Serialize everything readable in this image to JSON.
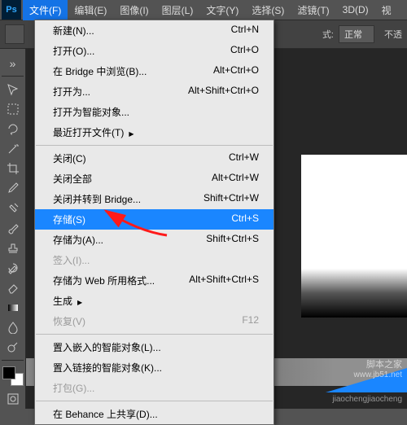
{
  "menubar": {
    "items": [
      {
        "label": "文件(F)"
      },
      {
        "label": "编辑(E)"
      },
      {
        "label": "图像(I)"
      },
      {
        "label": "图层(L)"
      },
      {
        "label": "文字(Y)"
      },
      {
        "label": "选择(S)"
      },
      {
        "label": "滤镜(T)"
      },
      {
        "label": "3D(D)"
      },
      {
        "label": "视"
      }
    ]
  },
  "options": {
    "mode_prefix": "式:",
    "mode_value": "正常",
    "opacity_label": "不透"
  },
  "dropdown": {
    "items": [
      {
        "label": "新建(N)...",
        "shortcut": "Ctrl+N"
      },
      {
        "label": "打开(O)...",
        "shortcut": "Ctrl+O"
      },
      {
        "label": "在 Bridge 中浏览(B)...",
        "shortcut": "Alt+Ctrl+O"
      },
      {
        "label": "打开为...",
        "shortcut": "Alt+Shift+Ctrl+O"
      },
      {
        "label": "打开为智能对象..."
      },
      {
        "label": "最近打开文件(T)",
        "submenu": true
      },
      {
        "sep": true
      },
      {
        "label": "关闭(C)",
        "shortcut": "Ctrl+W"
      },
      {
        "label": "关闭全部",
        "shortcut": "Alt+Ctrl+W"
      },
      {
        "label": "关闭并转到 Bridge...",
        "shortcut": "Shift+Ctrl+W"
      },
      {
        "label": "存储(S)",
        "shortcut": "Ctrl+S",
        "highlight": true
      },
      {
        "label": "存储为(A)...",
        "shortcut": "Shift+Ctrl+S"
      },
      {
        "label": "签入(I)...",
        "disabled": true
      },
      {
        "label": "存储为 Web 所用格式...",
        "shortcut": "Alt+Shift+Ctrl+S"
      },
      {
        "label": "生成",
        "submenu": true
      },
      {
        "label": "恢复(V)",
        "shortcut": "F12",
        "disabled": true
      },
      {
        "sep": true
      },
      {
        "label": "置入嵌入的智能对象(L)..."
      },
      {
        "label": "置入链接的智能对象(K)..."
      },
      {
        "label": "打包(G)...",
        "disabled": true
      },
      {
        "sep": true
      },
      {
        "label": "在 Behance 上共享(D)..."
      }
    ]
  },
  "watermark": {
    "line1": "脚本之家",
    "line2": "jiaochengjiaocheng"
  },
  "watermark_url": "www.jb51.net"
}
